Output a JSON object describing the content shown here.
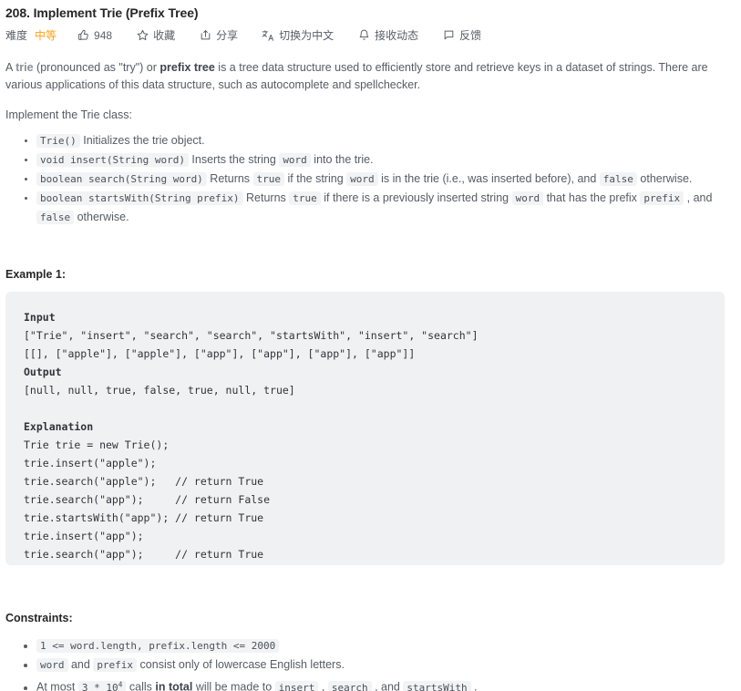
{
  "problem": {
    "title": "208. Implement Trie (Prefix Tree)"
  },
  "toolbar": {
    "difficulty_label": "难度",
    "difficulty_value": "中等",
    "difficulty_color": "#ffa116",
    "like_count": "948",
    "like_icon": "thumbs-up-icon",
    "favorite_label": "收藏",
    "favorite_icon": "star-icon",
    "share_label": "分享",
    "share_icon": "share-icon",
    "translate_label": "切换为中文",
    "translate_icon": "translate-icon",
    "subscribe_label": "接收动态",
    "subscribe_icon": "bell-icon",
    "feedback_label": "反馈",
    "feedback_icon": "comment-icon"
  },
  "description": {
    "p1_a": "A ",
    "p1_link": "trie",
    "p1_b": " (pronounced as \"try\") or ",
    "p1_bold": "prefix tree",
    "p1_c": " is a tree data structure used to efficiently store and retrieve keys in a dataset of strings. There are various applications of this data structure, such as autocomplete and spellchecker.",
    "p2": "Implement the Trie class:"
  },
  "methods": [
    {
      "code": "Trie()",
      "text_after": " Initializes the trie object.",
      "segments": [
        {
          "t": "code",
          "v": "Trie()"
        },
        {
          "t": "text",
          "v": " Initializes the trie object."
        }
      ]
    },
    {
      "segments": [
        {
          "t": "code",
          "v": "void insert(String word)"
        },
        {
          "t": "text",
          "v": " Inserts the string "
        },
        {
          "t": "code",
          "v": "word"
        },
        {
          "t": "text",
          "v": " into the trie."
        }
      ]
    },
    {
      "segments": [
        {
          "t": "code",
          "v": "boolean search(String word)"
        },
        {
          "t": "text",
          "v": " Returns "
        },
        {
          "t": "code",
          "v": "true"
        },
        {
          "t": "text",
          "v": " if the string "
        },
        {
          "t": "code",
          "v": "word"
        },
        {
          "t": "text",
          "v": " is in the trie (i.e., was inserted before), and "
        },
        {
          "t": "code",
          "v": "false"
        },
        {
          "t": "text",
          "v": " otherwise."
        }
      ]
    },
    {
      "segments": [
        {
          "t": "code",
          "v": "boolean startsWith(String prefix)"
        },
        {
          "t": "text",
          "v": " Returns "
        },
        {
          "t": "code",
          "v": "true"
        },
        {
          "t": "text",
          "v": " if there is a previously inserted string "
        },
        {
          "t": "code",
          "v": "word"
        },
        {
          "t": "text",
          "v": " that has the prefix "
        },
        {
          "t": "code",
          "v": "prefix"
        },
        {
          "t": "text",
          "v": " , and "
        },
        {
          "t": "code",
          "v": "false"
        },
        {
          "t": "text",
          "v": " otherwise."
        }
      ]
    }
  ],
  "example": {
    "heading": "Example 1:",
    "input_label": "Input",
    "input_line1": "[\"Trie\", \"insert\", \"search\", \"search\", \"startsWith\", \"insert\", \"search\"]",
    "input_line2": "[[], [\"apple\"], [\"apple\"], [\"app\"], [\"app\"], [\"app\"], [\"app\"]]",
    "output_label": "Output",
    "output_line": "[null, null, true, false, true, null, true]",
    "explanation_label": "Explanation",
    "explanation_lines": [
      "Trie trie = new Trie();",
      "trie.insert(\"apple\");",
      "trie.search(\"apple\");   // return True",
      "trie.search(\"app\");     // return False",
      "trie.startsWith(\"app\"); // return True",
      "trie.insert(\"app\");",
      "trie.search(\"app\");     // return True"
    ]
  },
  "constraints": {
    "heading": "Constraints:",
    "items": [
      {
        "segments": [
          {
            "t": "code",
            "v": "1 <= word.length, prefix.length <= 2000"
          }
        ]
      },
      {
        "segments": [
          {
            "t": "code",
            "v": "word"
          },
          {
            "t": "text",
            "v": " and "
          },
          {
            "t": "code",
            "v": "prefix"
          },
          {
            "t": "text",
            "v": " consist only of lowercase English letters."
          }
        ]
      },
      {
        "segments": [
          {
            "t": "text",
            "v": "At most "
          },
          {
            "t": "code-sup",
            "v": "3 * 10",
            "sup": "4"
          },
          {
            "t": "text",
            "v": " calls "
          },
          {
            "t": "bold",
            "v": "in total"
          },
          {
            "t": "text",
            "v": " will be made to "
          },
          {
            "t": "code",
            "v": "insert"
          },
          {
            "t": "text",
            "v": " , "
          },
          {
            "t": "code",
            "v": "search"
          },
          {
            "t": "text",
            "v": " , and "
          },
          {
            "t": "code",
            "v": "startsWith"
          },
          {
            "t": "text",
            "v": " ."
          }
        ]
      }
    ]
  }
}
